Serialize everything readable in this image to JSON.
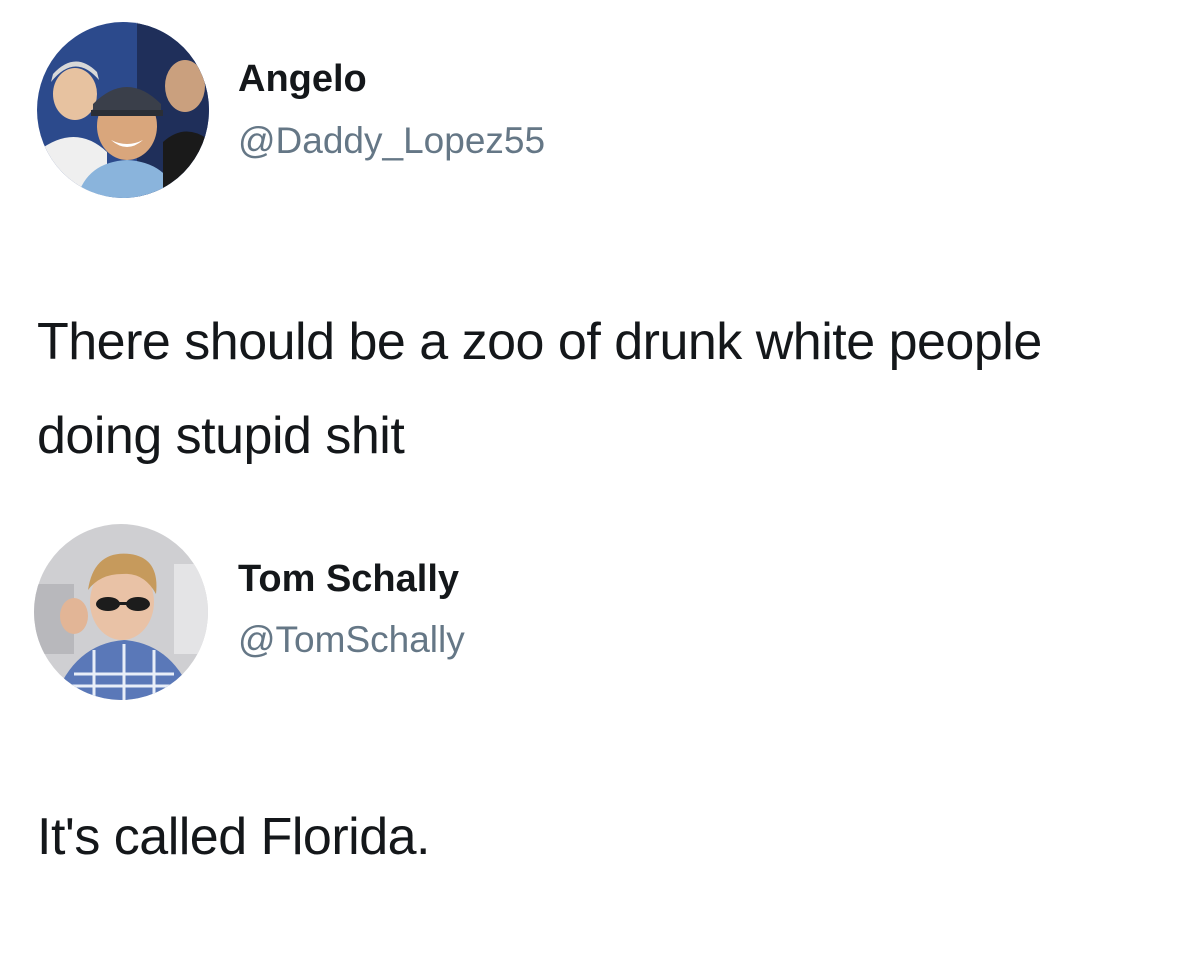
{
  "tweets": [
    {
      "display_name": "Angelo",
      "handle": "@Daddy_Lopez55",
      "text": "There should be a zoo of drunk white people doing stupid shit",
      "avatar_icon": "profile-photo-three-men"
    },
    {
      "display_name": "Tom Schally",
      "handle": "@TomSchally",
      "text": "It's called Florida.",
      "avatar_icon": "profile-photo-man-sunglasses"
    }
  ],
  "colors": {
    "name": "#14171a",
    "handle": "#657786",
    "background": "#ffffff"
  }
}
